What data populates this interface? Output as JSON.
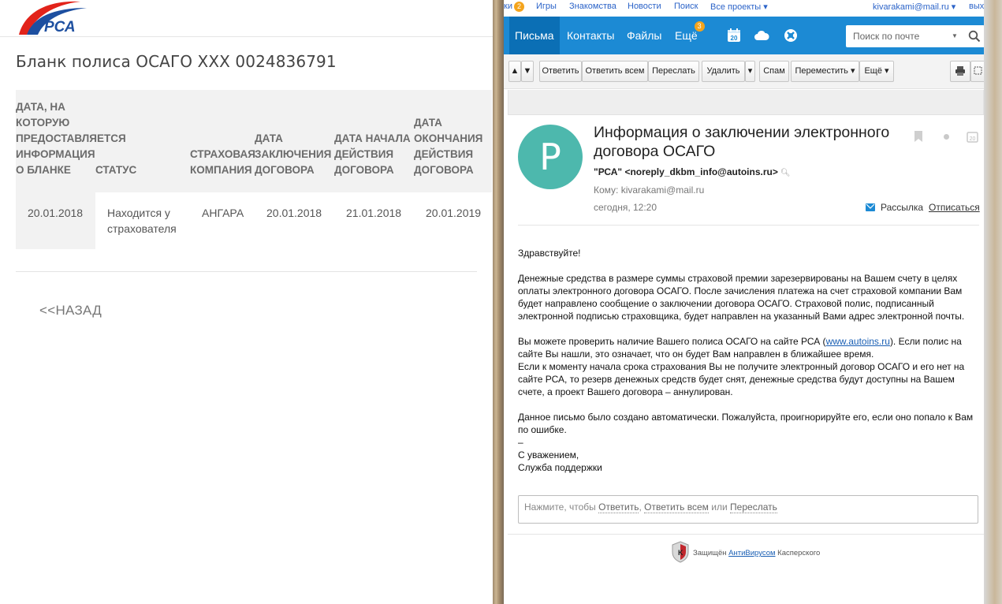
{
  "rsa": {
    "title": "Бланк полиса ОСАГО XXX 0024836791",
    "table": {
      "headers": [
        "ДАТА, НА КОТОРУЮ ПРЕДОСТАВЛЯЕТСЯ ИНФОРМАЦИЯ О БЛАНКЕ",
        "СТАТУС",
        "СТРАХОВАЯ КОМПАНИЯ",
        "ДАТА ЗАКЛЮЧЕНИЯ ДОГОВОРА",
        "ДАТА НАЧАЛА ДЕЙСТВИЯ ДОГОВОРА",
        "ДАТА ОКОНЧАНИЯ ДЕЙСТВИЯ ДОГОВОРА"
      ],
      "row": [
        "20.01.2018",
        "Находится у страхователя",
        "АНГАРА",
        "20.01.2018",
        "21.01.2018",
        "20.01.2019"
      ]
    },
    "back_label": "<<НАЗАД",
    "logo_text": "РСА"
  },
  "mail": {
    "topbar": {
      "items": [
        "ки",
        "Игры",
        "Знакомства",
        "Новости",
        "Поиск",
        "Все проекты ▾"
      ],
      "badge": "2",
      "user": "kivarakami@mail.ru ▾",
      "exit": "вых"
    },
    "nav": {
      "tabs": [
        "Письма",
        "Контакты",
        "Файлы",
        "Ещё"
      ],
      "more_badge": "3",
      "calendar_day": "20",
      "search_placeholder": "Поиск по почте"
    },
    "toolbar": {
      "reply": "Ответить",
      "reply_all": "Ответить всем",
      "forward": "Переслать",
      "delete": "Удалить",
      "spam": "Спам",
      "move": "Переместить ▾",
      "more": "Ещё ▾"
    },
    "message": {
      "avatar_letter": "P",
      "subject": "Информация о заключении электронного договора ОСАГО",
      "sender": "\"РСА\" <noreply_dkbm_info@autoins.ru>",
      "to": "Кому: kivarakami@mail.ru",
      "date": "сегодня, 12:20",
      "mailing_label": "Рассылка",
      "unsubscribe_label": "Отписаться",
      "header_calendar_day": "20",
      "greeting": "Здравствуйте!",
      "p1": "Денежные средства в размере суммы страховой премии зарезервированы на Вашем счету в целях оплаты электронного договора ОСАГО. После зачисления платежа на счет страховой компании Вам будет направлено сообщение о заключении договора ОСАГО. Страховой полис, подписанный электронной подписью страховщика, будет направлен на указанный Вами адрес электронной почты.",
      "p2_before": "Вы можете проверить наличие Вашего полиса ОСАГО на сайте РСА (",
      "p2_link": "www.autoins.ru",
      "p2_after": "). Если полис на сайте Вы нашли, это означает, что он будет Вам направлен в ближайшее время.",
      "p3": "Если к моменту начала срока страхования Вы не получите электронный договор ОСАГО и его нет на сайте РСА, то резерв денежных средств будет снят, денежные средства будут доступны на Вашем счете, а проект Вашего договора – аннулирован.",
      "p4": "Данное письмо было создано автоматически. Пожалуйста, проигнорируйте его, если оно попало к Вам по ошибке.",
      "dash": "–",
      "regards": "С уважением,",
      "signature": "Служба поддержки"
    },
    "reply_box": {
      "prefix": "Нажмите, чтобы",
      "reply": "Ответить",
      "comma": ",",
      "reply_all": "Ответить всем",
      "or": "или",
      "forward": "Переслать"
    },
    "kaspersky": {
      "prefix": "Защищён",
      "link": "АнтиВирусом",
      "suffix": "Касперского"
    }
  }
}
